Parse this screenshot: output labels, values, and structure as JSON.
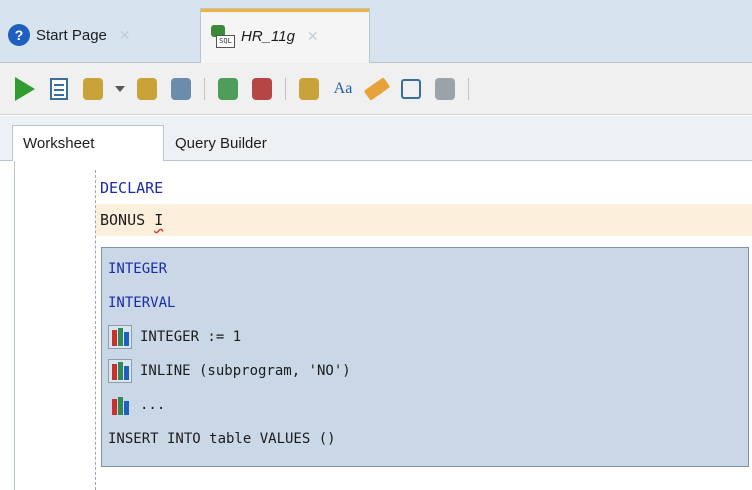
{
  "tabs": [
    {
      "label": "Start Page"
    },
    {
      "label": "HR_11g"
    }
  ],
  "toolbar": {
    "icons": [
      "run-statement-icon",
      "run-script-icon",
      "commit-icon",
      "dropdown-caret-icon",
      "rollback-icon",
      "explain-plan-icon",
      "autotrace-icon",
      "sql-history-icon",
      "sql-icon",
      "translate-case-icon",
      "clear-icon",
      "clock-icon",
      "tools-icon"
    ]
  },
  "subtabs": {
    "worksheet": "Worksheet",
    "query_builder": "Query Builder"
  },
  "editor": {
    "line1": "DECLARE",
    "line2_prefix": "BONUS ",
    "line2_typed": "I"
  },
  "autocomplete": [
    {
      "text": "INTEGER",
      "kind": "keyword"
    },
    {
      "text": "INTERVAL",
      "kind": "keyword"
    },
    {
      "text": "INTEGER := 1",
      "kind": "snippet"
    },
    {
      "text": "INLINE (subprogram, 'NO')",
      "kind": "snippet"
    },
    {
      "text": "...",
      "kind": "snippet"
    },
    {
      "text": "INSERT INTO table VALUES ()",
      "kind": "plain"
    }
  ]
}
